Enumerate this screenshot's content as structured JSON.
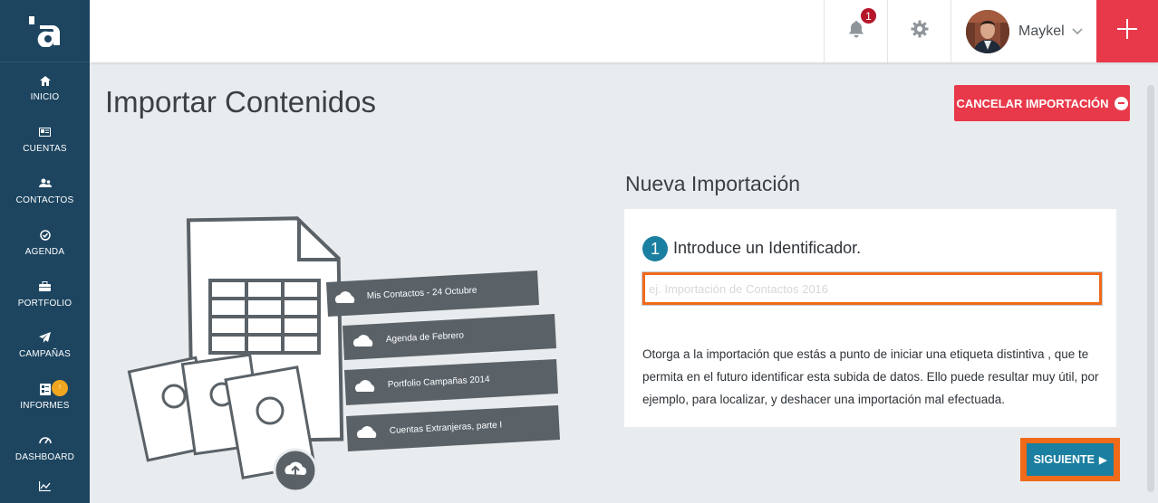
{
  "sidebar": {
    "logo_text": "'a",
    "items": [
      {
        "label": "INICIO",
        "icon": "home-icon"
      },
      {
        "label": "CUENTAS",
        "icon": "id-card-icon"
      },
      {
        "label": "CONTACTOS",
        "icon": "users-icon"
      },
      {
        "label": "AGENDA",
        "icon": "check-circle-icon"
      },
      {
        "label": "PORTFOLIO",
        "icon": "briefcase-icon"
      },
      {
        "label": "CAMPAÑAS",
        "icon": "paper-plane-icon"
      },
      {
        "label": "INFORMES",
        "icon": "report-icon",
        "badge": "!"
      },
      {
        "label": "DASHBOARD",
        "icon": "gauge-icon"
      },
      {
        "label": "",
        "icon": "line-chart-icon"
      }
    ]
  },
  "topbar": {
    "notification_count": "1",
    "user_name": "Maykel"
  },
  "main": {
    "page_title": "Importar Contenidos",
    "cancel_label": "CANCELAR IMPORTACIÓN",
    "section_title": "Nueva Importación",
    "step_number": "1",
    "step_label": "Introduce un Identificador.",
    "id_placeholder": "ej. Importación de Contactos 2016",
    "id_value": "",
    "description": "Otorga a la importación que estás a punto de iniciar una etiqueta distintiva , que te permita en el futuro identificar esta subida de datos. Ello puede resultar muy útil, por ejemplo, para localizar, y deshacer una importación mal efectuada.",
    "next_label": "SIGUIENTE"
  },
  "illustration": {
    "ribbons": [
      "Mis Contactos - 24 Octubre",
      "Agenda de Febrero",
      "Portfolio Campañas 2014",
      "Cuentas Extranjeras, parte I"
    ]
  },
  "colors": {
    "sidebar": "#1d4560",
    "accent_red": "#e8394a",
    "accent_blue": "#1a7fa0",
    "highlight_orange": "#f06a1a"
  }
}
